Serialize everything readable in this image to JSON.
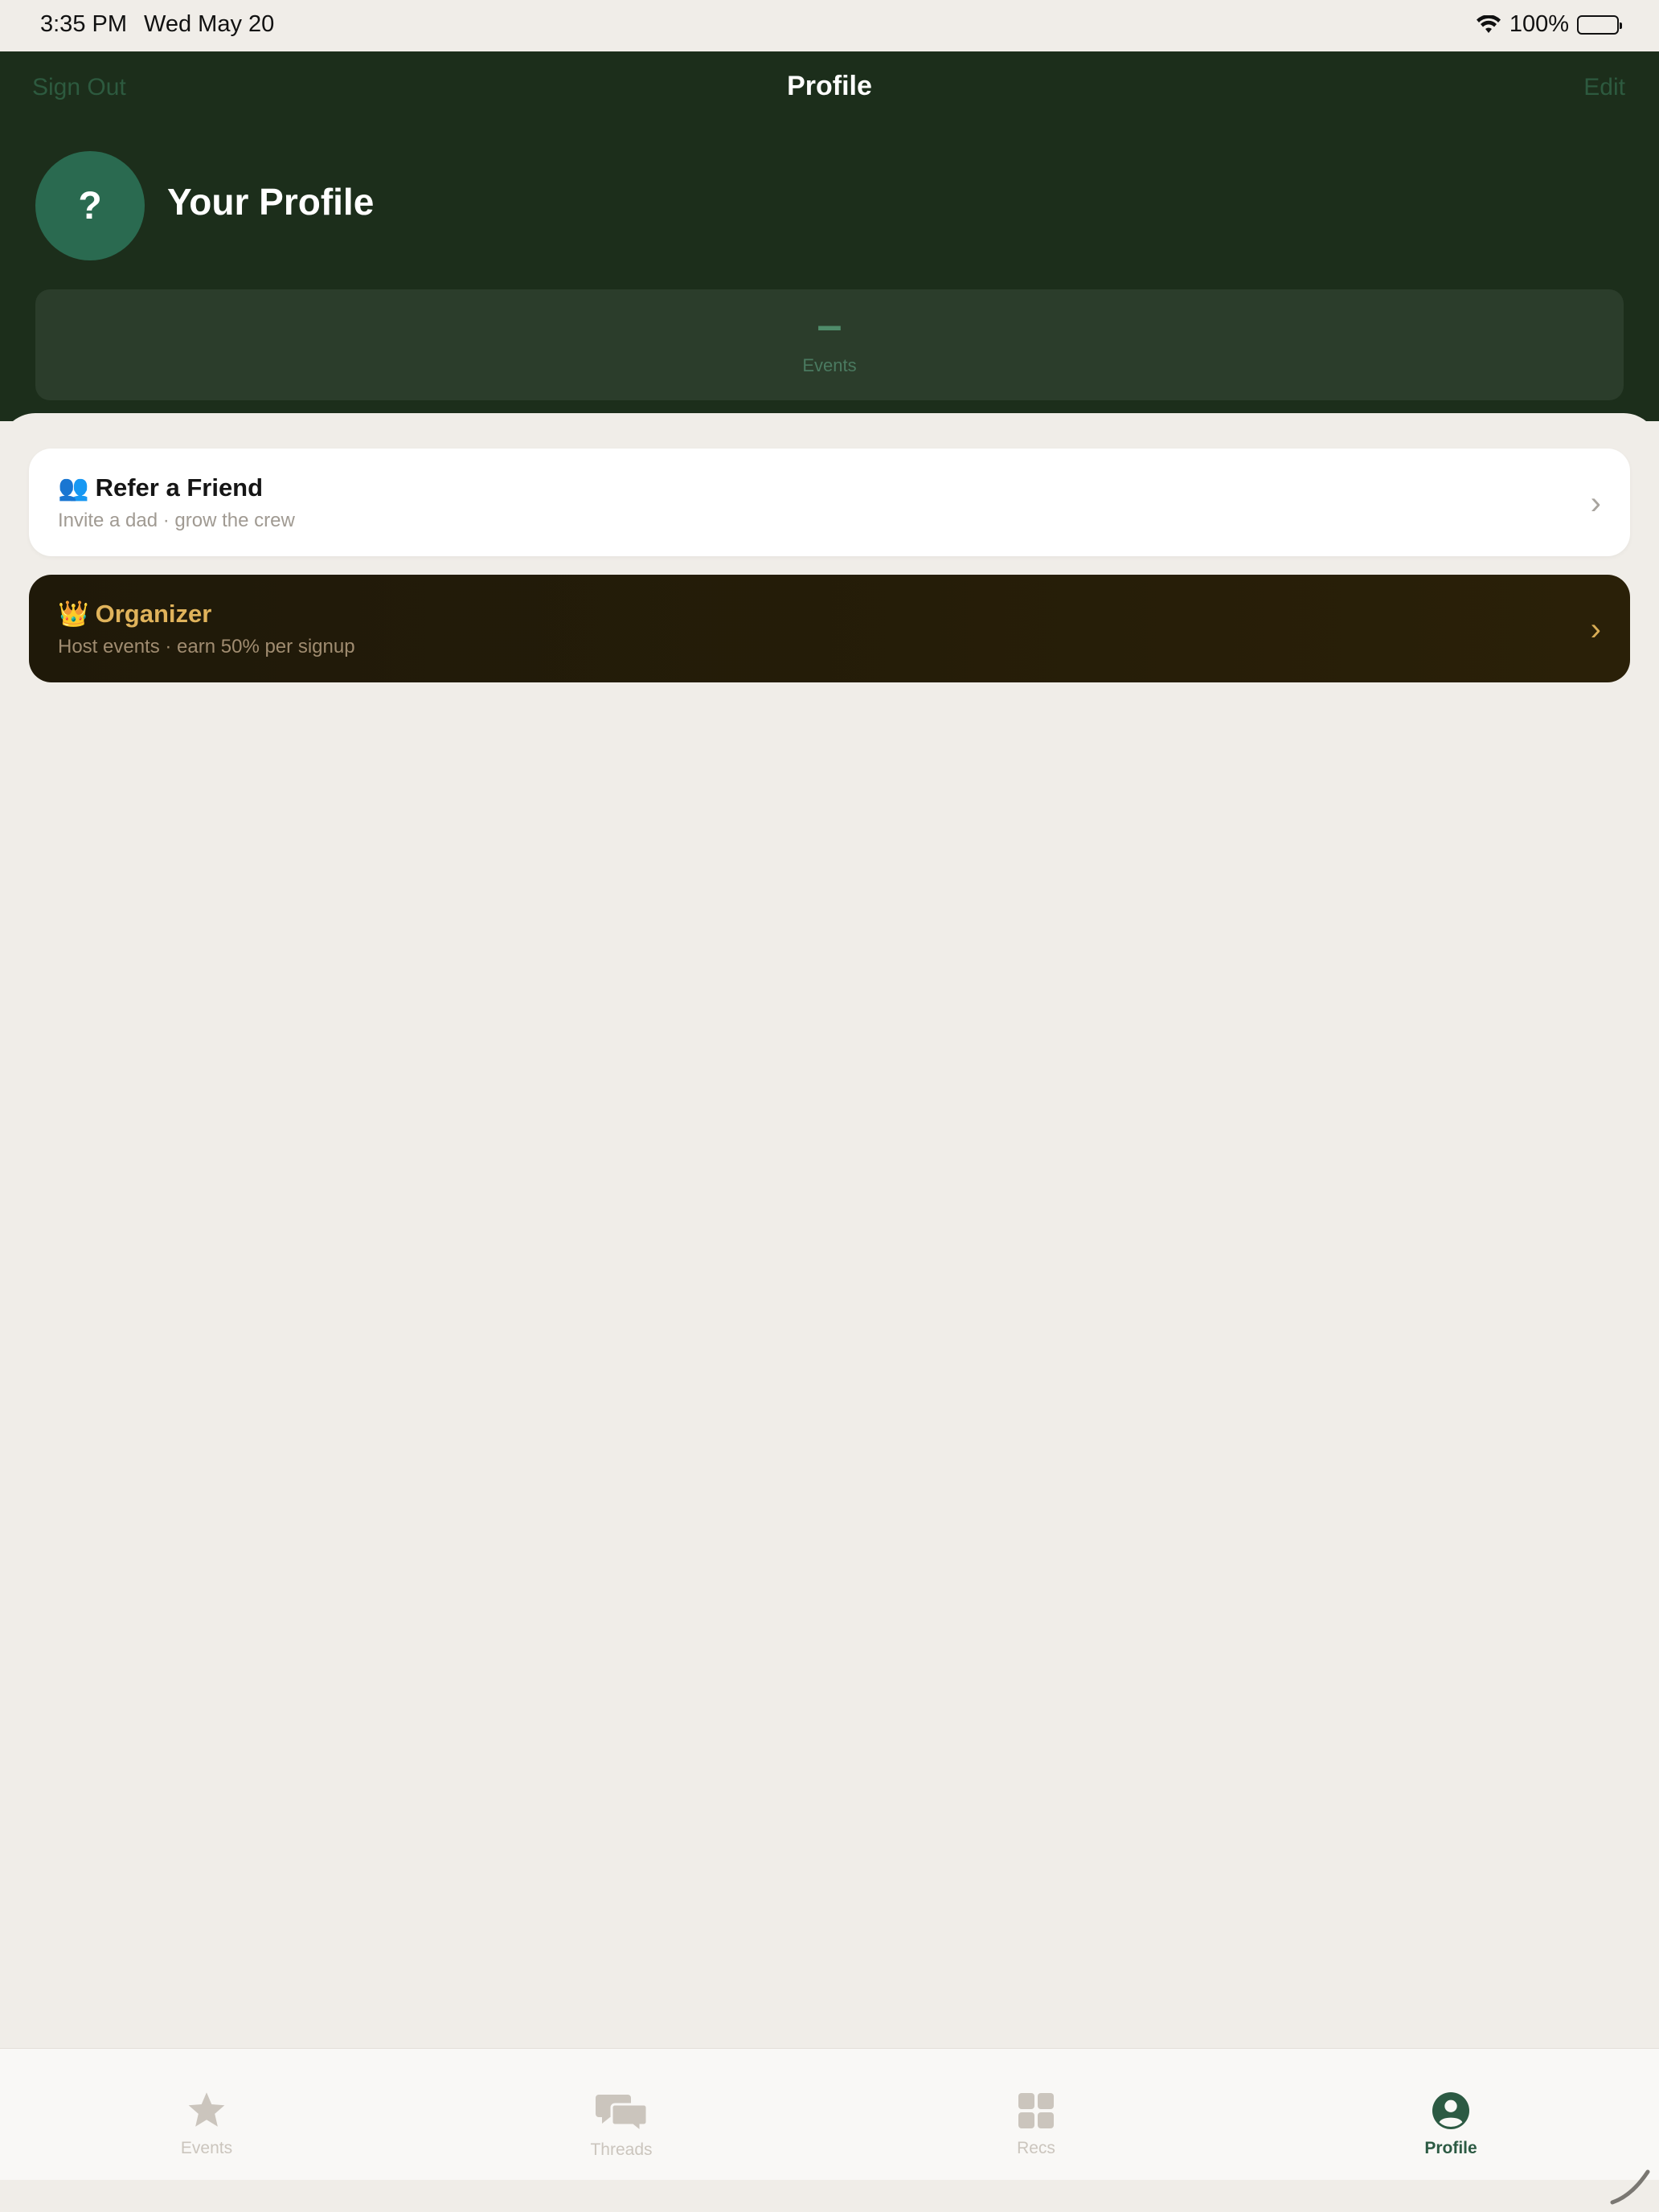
{
  "status_bar": {
    "time": "3:35 PM",
    "date": "Wed May 20",
    "battery": "100%",
    "wifi_icon": "wifi-icon",
    "battery_icon": "battery-icon"
  },
  "nav": {
    "left_button": "Sign Out",
    "title": "Profile",
    "right_button": "Edit"
  },
  "profile": {
    "avatar_text": "?",
    "name": "Your Profile"
  },
  "stats": [
    {
      "value": "–",
      "label": "Events"
    }
  ],
  "cards": [
    {
      "emoji": "👥",
      "title": "Refer a Friend",
      "subtitle": "Invite a dad · grow the crew",
      "chevron": "›"
    },
    {
      "emoji": "👑",
      "title": "Organizer",
      "subtitle": "Host events · earn 50% per signup",
      "chevron": "›"
    }
  ],
  "tabs": [
    {
      "label": "Events",
      "icon": "star-icon",
      "active": false
    },
    {
      "label": "Threads",
      "icon": "chat-bubbles-icon",
      "active": false
    },
    {
      "label": "Recs",
      "icon": "grid-icon",
      "active": false
    },
    {
      "label": "Profile",
      "icon": "person-circle-icon",
      "active": true
    }
  ],
  "colors": {
    "header_bg": "#1c2e1b",
    "accent_green": "#2c5a43",
    "organizer_gold": "#e0b35b",
    "page_bg": "#f0ede8"
  }
}
